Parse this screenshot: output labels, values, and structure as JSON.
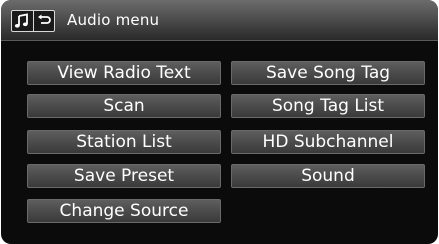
{
  "window": {
    "title": "Audio menu"
  },
  "title_icons": [
    "music-note-icon",
    "back-arrow-icon"
  ],
  "menu": {
    "left": [
      "View Radio Text",
      "Scan",
      "Station List",
      "Save Preset",
      "Change Source"
    ],
    "right": [
      "Save Song Tag",
      "Song Tag List",
      "HD Subchannel",
      "Sound"
    ]
  },
  "colors": {
    "background": "#0b0b0b",
    "button": "#4b4b4b",
    "text": "#ffffff"
  }
}
